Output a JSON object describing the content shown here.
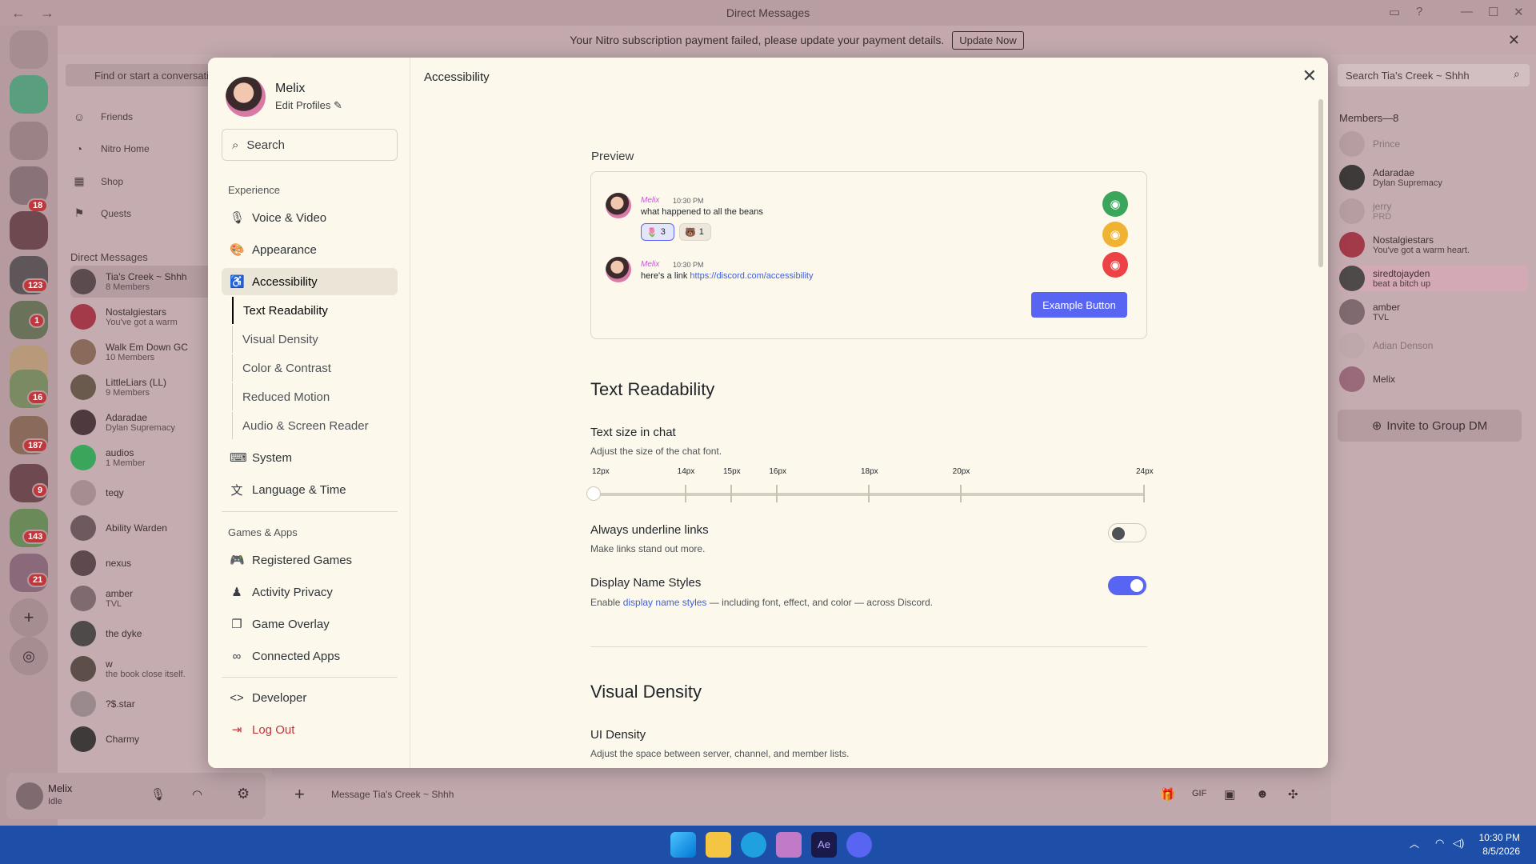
{
  "window": {
    "title": "Direct Messages"
  },
  "notice": {
    "text": "Your Nitro subscription payment failed, please update your payment details.",
    "button": "Update Now"
  },
  "rail": {
    "badges": [
      "18",
      "123",
      "1",
      "16",
      "187",
      "9",
      "143",
      "21"
    ]
  },
  "dm_sidebar": {
    "search_placeholder": "Find or start a conversation",
    "nav": [
      {
        "label": "Friends",
        "icon": "friends-icon"
      },
      {
        "label": "Nitro Home",
        "icon": "nitro-icon"
      },
      {
        "label": "Shop",
        "icon": "shop-icon"
      },
      {
        "label": "Quests",
        "icon": "quests-icon"
      }
    ],
    "header": "Direct Messages",
    "items": [
      {
        "name": "Tia's Creek ~ Shhh",
        "sub": "8 Members"
      },
      {
        "name": "Nostalgiestars",
        "sub": "You've got a warm"
      },
      {
        "name": "Walk Em Down GC",
        "sub": "10 Members"
      },
      {
        "name": "LittleLiars (LL)",
        "sub": "9 Members"
      },
      {
        "name": "Adaradae",
        "sub": "Dylan Supremacy"
      },
      {
        "name": "audios",
        "sub": "1 Member"
      },
      {
        "name": "teqy",
        "sub": ""
      },
      {
        "name": "Ability Warden",
        "sub": ""
      },
      {
        "name": "nexus",
        "sub": ""
      },
      {
        "name": "amber",
        "sub": "TVL"
      },
      {
        "name": "the dyke",
        "sub": ""
      },
      {
        "name": "w",
        "sub": "the book close itself."
      },
      {
        "name": "?$.star",
        "sub": ""
      },
      {
        "name": "Charmy",
        "sub": ""
      }
    ]
  },
  "user_panel": {
    "name": "Melix",
    "status": "Idle"
  },
  "chat_input": {
    "placeholder": "Message Tia's Creek ~ Shhh"
  },
  "members": {
    "search_placeholder": "Search Tia's Creek ~ Shhh",
    "header": "Members—8",
    "items": [
      {
        "name": "Prince",
        "sub": ""
      },
      {
        "name": "Adaradae",
        "sub": "Dylan Supremacy"
      },
      {
        "name": "jerry",
        "sub": "PRD"
      },
      {
        "name": "Nostalgiestars",
        "sub": "You've got a warm heart."
      },
      {
        "name": "siredtojayden",
        "sub": "beat a bitch up"
      },
      {
        "name": "amber",
        "sub": "TVL"
      },
      {
        "name": "Adian Denson",
        "sub": ""
      },
      {
        "name": "Melix",
        "sub": ""
      }
    ],
    "invite": "Invite to Group DM"
  },
  "settings": {
    "profile": {
      "name": "Melix",
      "edit": "Edit Profiles"
    },
    "search": "Search",
    "section_experience": "Experience",
    "nav_experience": [
      {
        "label": "Voice & Video",
        "icon": "microphone-icon"
      },
      {
        "label": "Appearance",
        "icon": "palette-icon"
      },
      {
        "label": "Accessibility",
        "icon": "accessibility-icon"
      }
    ],
    "sub_items": [
      "Text Readability",
      "Visual Density",
      "Color & Contrast",
      "Reduced Motion",
      "Audio & Screen Reader"
    ],
    "nav_more": [
      {
        "label": "System",
        "icon": "keyboard-icon"
      },
      {
        "label": "Language & Time",
        "icon": "language-icon"
      }
    ],
    "section_games": "Games & Apps",
    "nav_games": [
      {
        "label": "Registered Games",
        "icon": "gamepad-icon"
      },
      {
        "label": "Activity Privacy",
        "icon": "person-lock-icon"
      },
      {
        "label": "Game Overlay",
        "icon": "overlay-icon"
      },
      {
        "label": "Connected Apps",
        "icon": "link-icon"
      }
    ],
    "developer": "Developer",
    "logout": "Log Out"
  },
  "content": {
    "title": "Accessibility",
    "preview_label": "Preview",
    "messages": [
      {
        "name": "Melix",
        "time": "10:30 PM",
        "text": "what happened to all the beans",
        "reactions": [
          "3",
          "1"
        ]
      },
      {
        "name": "Melix",
        "time": "10:30 PM",
        "text": "here's a link ",
        "link": "https://discord.com/accessibility"
      }
    ],
    "example_button": "Example Button",
    "text_readability": "Text Readability",
    "text_size_title": "Text size in chat",
    "text_size_desc": "Adjust the size of the chat font.",
    "slider_ticks": [
      "12px",
      "14px",
      "15px",
      "16px",
      "18px",
      "20px",
      "24px"
    ],
    "slider_value": "12px",
    "underline_title": "Always underline links",
    "underline_desc": "Make links stand out more.",
    "underline_on": false,
    "name_styles_title": "Display Name Styles",
    "name_styles_desc_pre": "Enable ",
    "name_styles_link": "display name styles",
    "name_styles_desc_post": " — including font, effect, and color — across Discord.",
    "name_styles_on": true,
    "visual_density": "Visual Density",
    "ui_density_title": "UI Density",
    "ui_density_desc": "Adjust the space between server, channel, and member lists."
  },
  "taskbar": {
    "time": "10:30 PM",
    "date": "8/5/2026"
  },
  "colors": {
    "accent": "#5865f2",
    "danger": "#c0373b"
  }
}
